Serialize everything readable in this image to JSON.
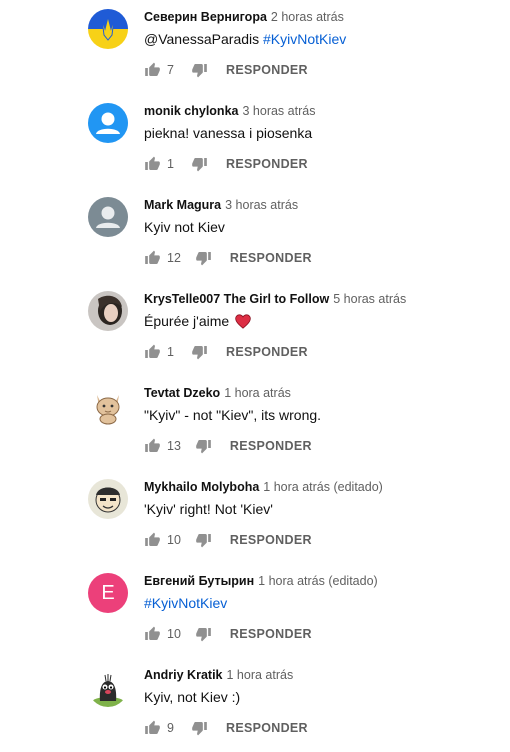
{
  "comments": [
    {
      "author": "Северин Вернигора",
      "time": "2 horas atrás",
      "text_prefix": "@VanessaParadis ",
      "hashtag": "#KyivNotKiev",
      "likes": "7",
      "reply_label": "RESPONDER",
      "avatar": "ukraine-flag-trident"
    },
    {
      "author": "monik chylonka",
      "time": "3 horas atrás",
      "text_prefix": "piekna! vanessa i piosenka",
      "hashtag": "",
      "likes": "1",
      "reply_label": "RESPONDER",
      "avatar": "default-blue"
    },
    {
      "author": "Mark Magura",
      "time": "3 horas atrás",
      "text_prefix": "Kyiv not Kiev",
      "hashtag": "",
      "likes": "12",
      "reply_label": "RESPONDER",
      "avatar": "default-gray"
    },
    {
      "author": "KrysTelle007 The Girl to Follow",
      "time": "5 horas atrás",
      "text_prefix": "Épurée j'aime",
      "hashtag": "",
      "likes": "1",
      "reply_label": "RESPONDER",
      "avatar": "photo-portrait",
      "emoji": "heart"
    },
    {
      "author": "Tevtat Dzeko",
      "time": "1 hora atrás",
      "text_prefix": "\"Kyiv\" - not \"Kiev\", its wrong.",
      "hashtag": "",
      "likes": "13",
      "reply_label": "RESPONDER",
      "avatar": "cartoon-cat"
    },
    {
      "author": "Mykhailo Molyboha",
      "time": "1 hora atrás (editado)",
      "text_prefix": "'Kyiv' right! Not 'Kiev'",
      "hashtag": "",
      "likes": "10",
      "reply_label": "RESPONDER",
      "avatar": "cartoon-face"
    },
    {
      "author": "Евгений Бутырин",
      "time": "1 hora atrás (editado)",
      "text_prefix": "",
      "hashtag": "#KyivNotKiev",
      "likes": "10",
      "reply_label": "RESPONDER",
      "avatar": "letter-e",
      "avatar_letter": "E"
    },
    {
      "author": "Andriy Kratik",
      "time": "1 hora atrás",
      "text_prefix": "Kyiv, not Kiev :)",
      "hashtag": "",
      "likes": "9",
      "reply_label": "RESPONDER",
      "avatar": "cartoon-mole"
    }
  ],
  "colors": {
    "hashtag": "#065fd4",
    "meta": "#606060",
    "avatar_e": "#ec407a",
    "avatar_default_blue": "#2196f3",
    "avatar_default_gray": "#7c8b94"
  }
}
